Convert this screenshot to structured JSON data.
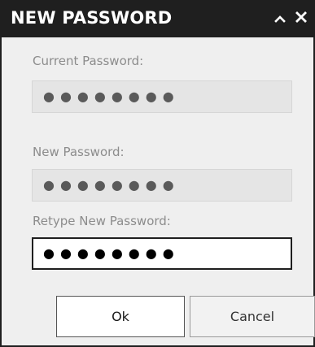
{
  "dialog": {
    "title": "NEW PASSWORD",
    "collapse_icon": "chevron-up-icon",
    "close_icon": "close-icon"
  },
  "fields": {
    "current": {
      "label": "Current Password:",
      "value": "●●●●●●●●"
    },
    "new": {
      "label": "New Password:",
      "value": "●●●●●●●●"
    },
    "retype": {
      "label": "Retype New Password:",
      "value": "●●●●●●●●"
    }
  },
  "buttons": {
    "ok": "Ok",
    "cancel": "Cancel"
  }
}
